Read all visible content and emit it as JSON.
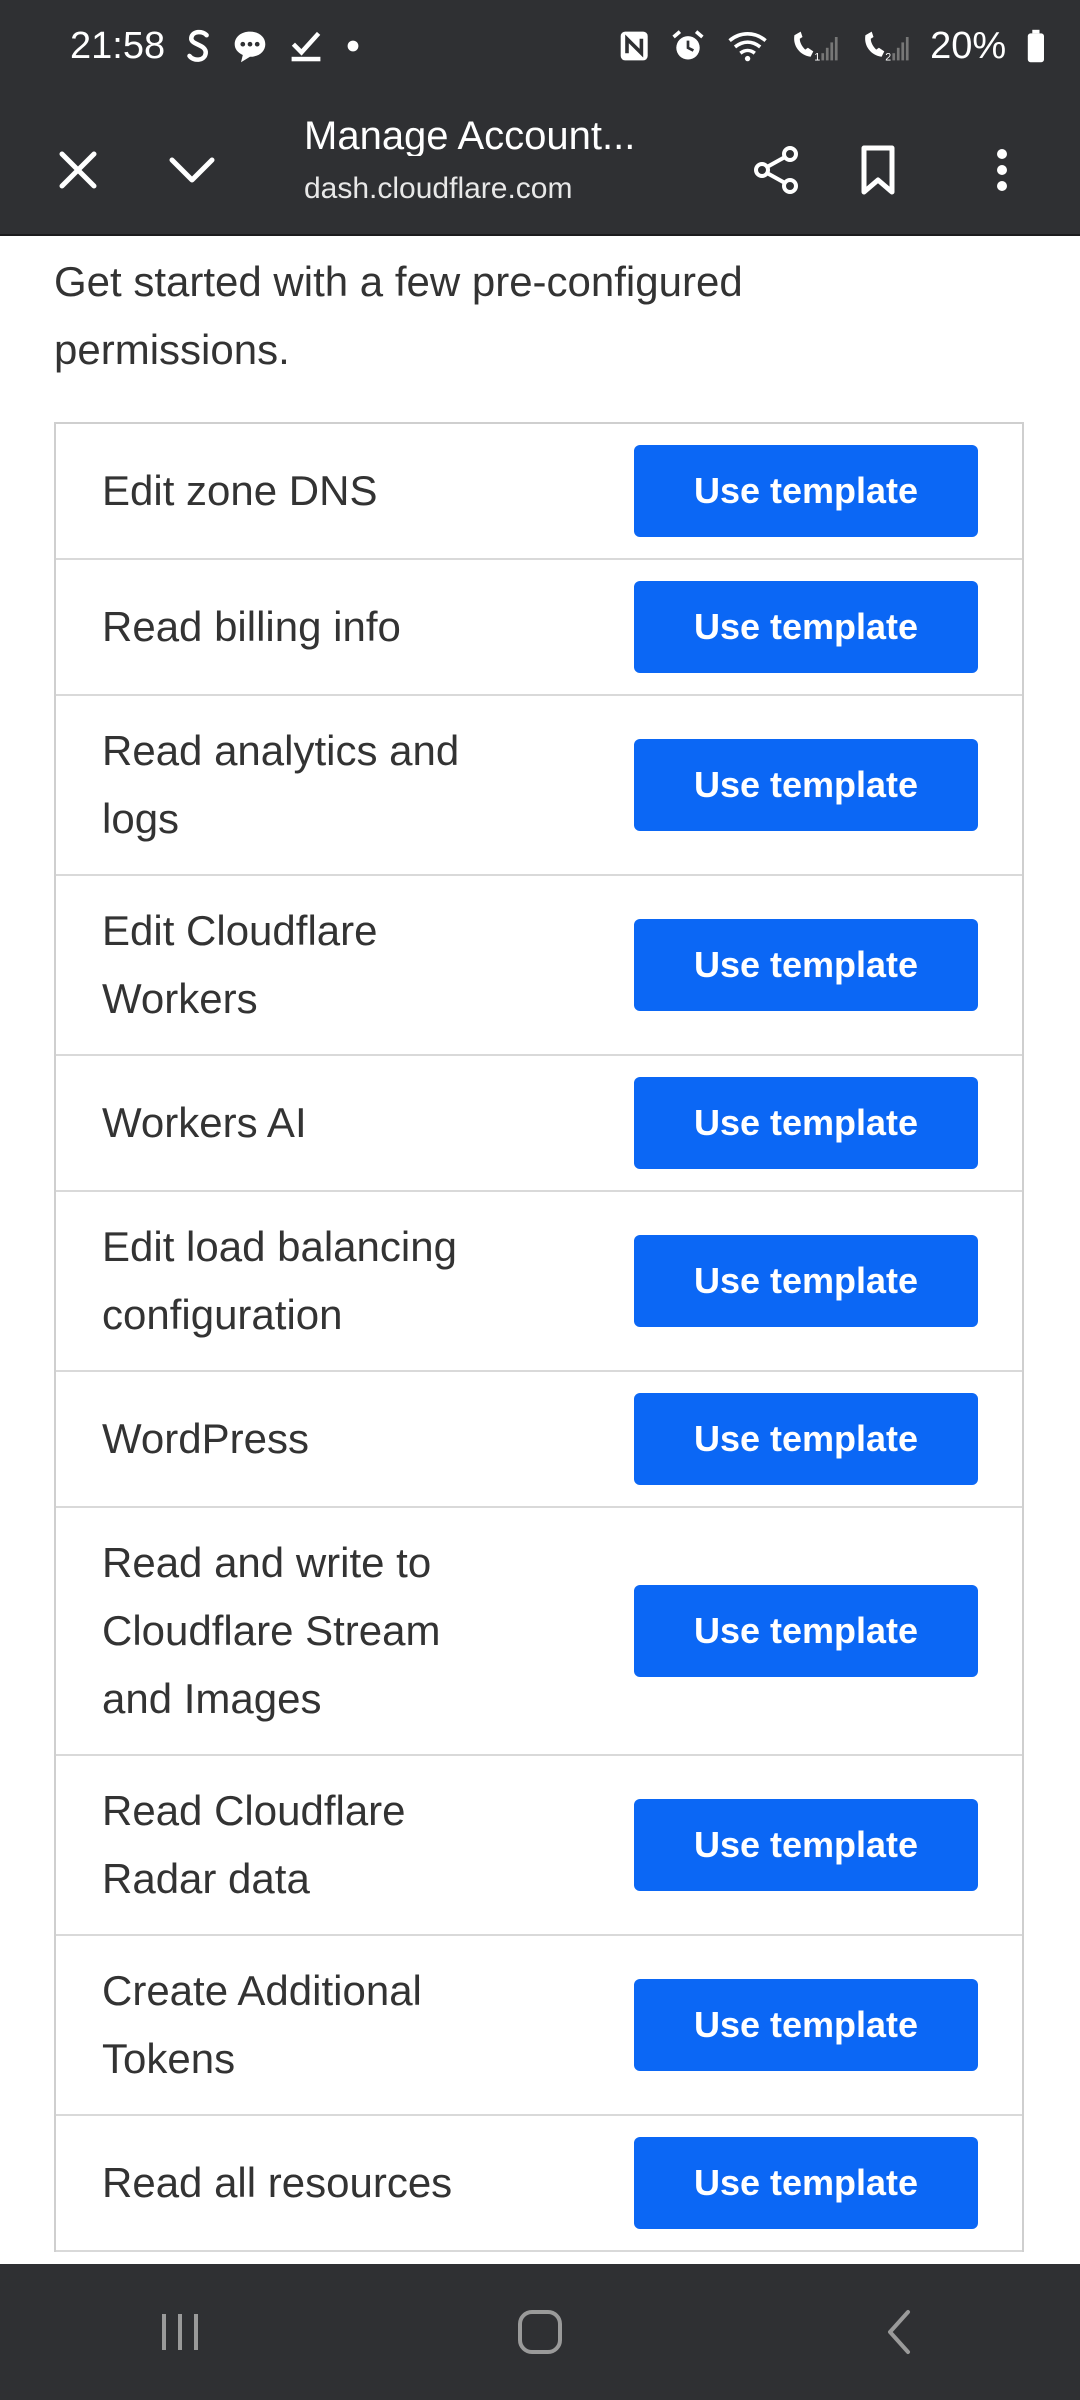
{
  "status_bar": {
    "time": "21:58",
    "battery": "20%",
    "left_icons": [
      "s-app-icon",
      "chat-icon",
      "checkbox-icon",
      "dot-icon"
    ],
    "right_icons": [
      "nfc-icon",
      "alarm-icon",
      "wifi-icon",
      "signal-1-icon",
      "signal-2-icon",
      "battery-icon"
    ]
  },
  "toolbar": {
    "title": "Manage Account...",
    "url": "dash.cloudflare.com"
  },
  "intro": "Get started with a few pre-configured permissions.",
  "templates": [
    {
      "label": "Edit zone DNS",
      "button": "Use template"
    },
    {
      "label": "Read billing info",
      "button": "Use template"
    },
    {
      "label": "Read analytics and logs",
      "button": "Use template"
    },
    {
      "label": "Edit Cloudflare Workers",
      "button": "Use template"
    },
    {
      "label": "Workers AI",
      "button": "Use template"
    },
    {
      "label": "Edit load balancing configuration",
      "button": "Use template"
    },
    {
      "label": "WordPress",
      "button": "Use template"
    },
    {
      "label": "Read and write to Cloudflare Stream and Images",
      "button": "Use template"
    },
    {
      "label": "Read Cloudflare Radar data",
      "button": "Use template"
    },
    {
      "label": "Create Additional Tokens",
      "button": "Use template"
    },
    {
      "label": "Read all resources",
      "button": "Use template"
    }
  ],
  "colors": {
    "bar_background": "#2f3033",
    "button_blue": "#0b67f5",
    "text": "#333333"
  }
}
